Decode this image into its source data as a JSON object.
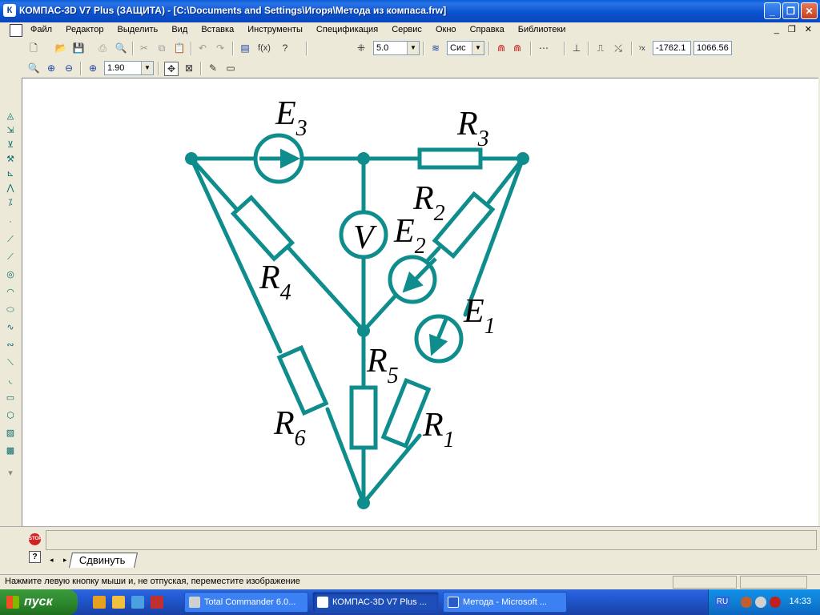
{
  "window": {
    "title": "КОМПАС-3D V7 Plus (ЗАЩИТА) - [C:\\Documents and Settings\\Игоря\\Метода из компаса.frw]",
    "controls": [
      "_",
      "❐",
      "✕"
    ]
  },
  "menu": {
    "items": [
      "Файл",
      "Редактор",
      "Выделить",
      "Вид",
      "Вставка",
      "Инструменты",
      "Спецификация",
      "Сервис",
      "Окно",
      "Справка",
      "Библиотеки"
    ],
    "mdi_controls": "_ ❐ ✕"
  },
  "toolbar1": {
    "step_value": "5.0",
    "style_value": "Сис",
    "formula_label": "f(x)",
    "coord_x": "-1762.1",
    "coord_y": "1066.56"
  },
  "toolbar2": {
    "zoom_value": "1.90"
  },
  "schematic": {
    "labels": {
      "e3": "E",
      "e3_sub": "3",
      "r3": "R",
      "r3_sub": "3",
      "r2": "R",
      "r2_sub": "2",
      "e2": "E",
      "e2_sub": "2",
      "v": "V",
      "r4": "R",
      "r4_sub": "4",
      "e1": "E",
      "e1_sub": "1",
      "r5": "R",
      "r5_sub": "5",
      "r1": "R",
      "r1_sub": "1",
      "r6": "R",
      "r6_sub": "6"
    },
    "color": "#0f8c8c"
  },
  "bottom_panel": {
    "stop_label": "STOP",
    "help_label": "?",
    "tab_arrows": "◂ ▸",
    "tab_label": "Сдвинуть"
  },
  "status": {
    "message": "Нажмите левую кнопку мыши и, не отпуская, переместите изображение"
  },
  "taskbar": {
    "start_label": "пуск",
    "tasks": [
      "Total Commander 6.0...",
      "КОМПАС-3D V7 Plus ...",
      "Метода - Microsoft ..."
    ],
    "language": "RU",
    "clock": "14:33"
  }
}
